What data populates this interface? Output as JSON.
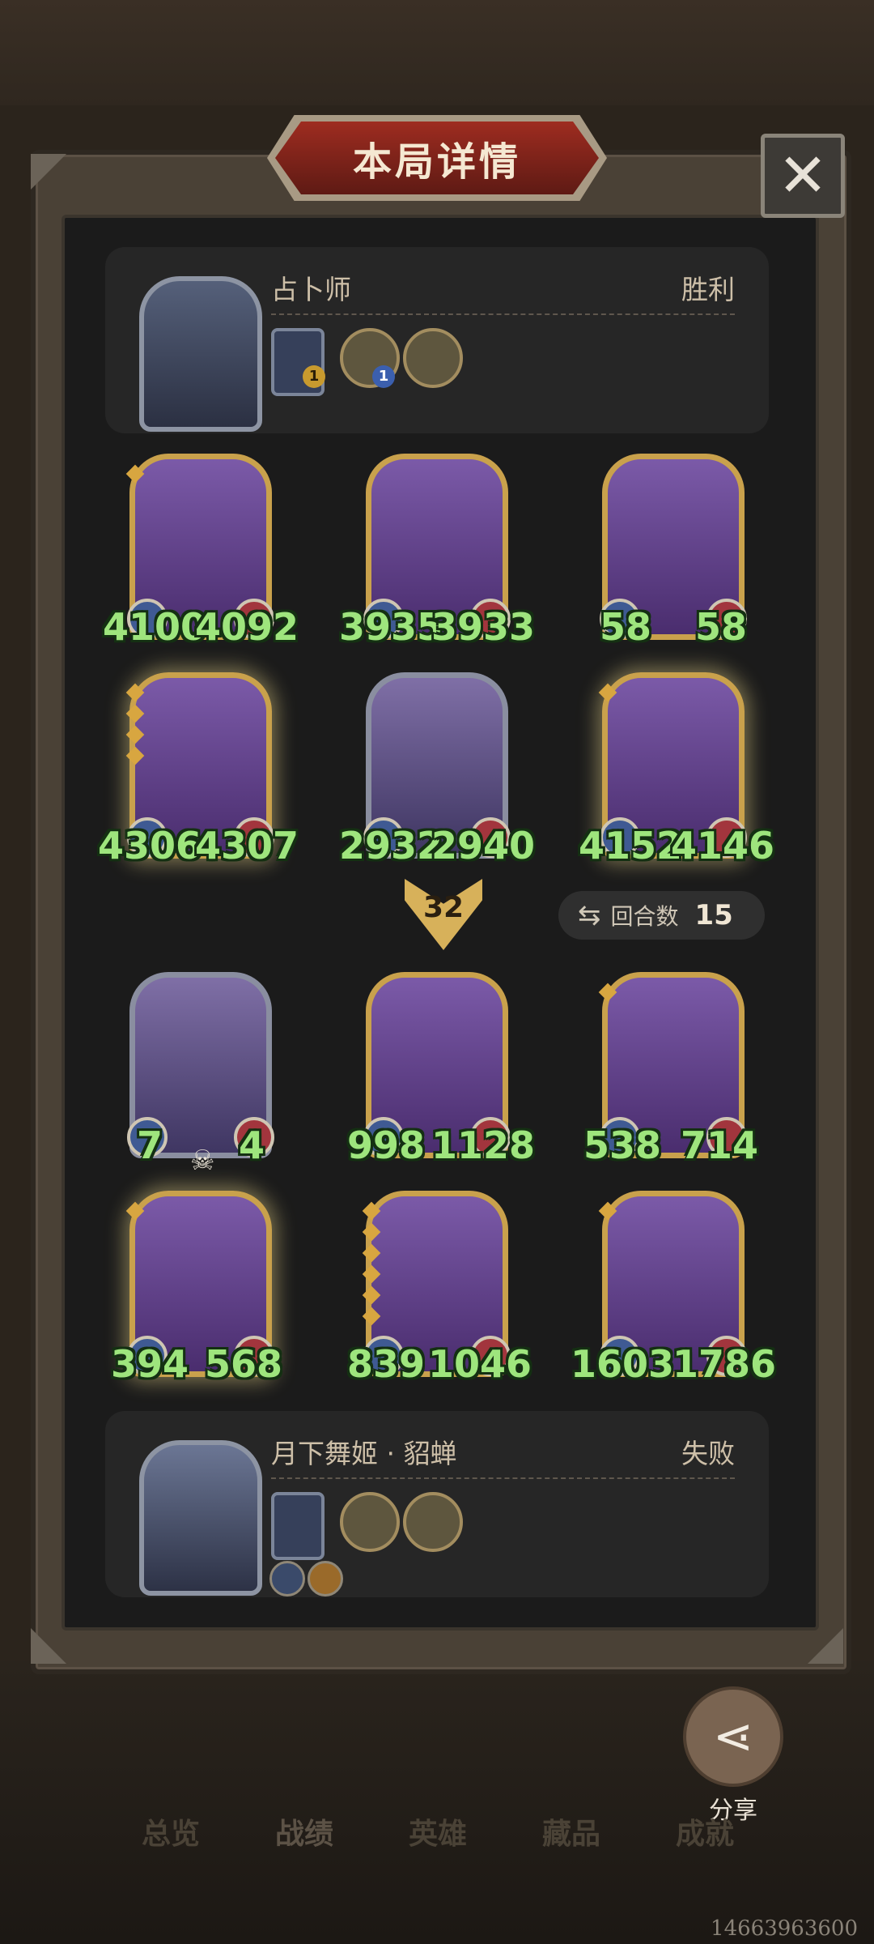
{
  "title": "本局详情",
  "players": {
    "top": {
      "name": "占卜师",
      "result": "胜利",
      "item_badges": [
        "1",
        "1"
      ]
    },
    "bottom": {
      "name": "月下舞姬 · 貂蝉",
      "result": "失败"
    }
  },
  "top_units": [
    {
      "atk": "4100",
      "hp": "4092"
    },
    {
      "atk": "3935",
      "hp": "3933"
    },
    {
      "atk": "58",
      "hp": "58"
    },
    {
      "atk": "4306",
      "hp": "4307"
    },
    {
      "atk": "2932",
      "hp": "2940"
    },
    {
      "atk": "4152",
      "hp": "4146"
    }
  ],
  "turn_number": "32",
  "rounds": {
    "label": "回合数",
    "value": "15"
  },
  "bottom_units": [
    {
      "atk": "7",
      "hp": "4"
    },
    {
      "atk": "998",
      "hp": "1128"
    },
    {
      "atk": "538",
      "hp": "714"
    },
    {
      "atk": "394",
      "hp": "568"
    },
    {
      "atk": "839",
      "hp": "1046"
    },
    {
      "atk": "1603",
      "hp": "1786"
    }
  ],
  "share_label": "分享",
  "nav": [
    "总览",
    "战绩",
    "英雄",
    "藏品",
    "成就"
  ],
  "user_id": "14663963600"
}
